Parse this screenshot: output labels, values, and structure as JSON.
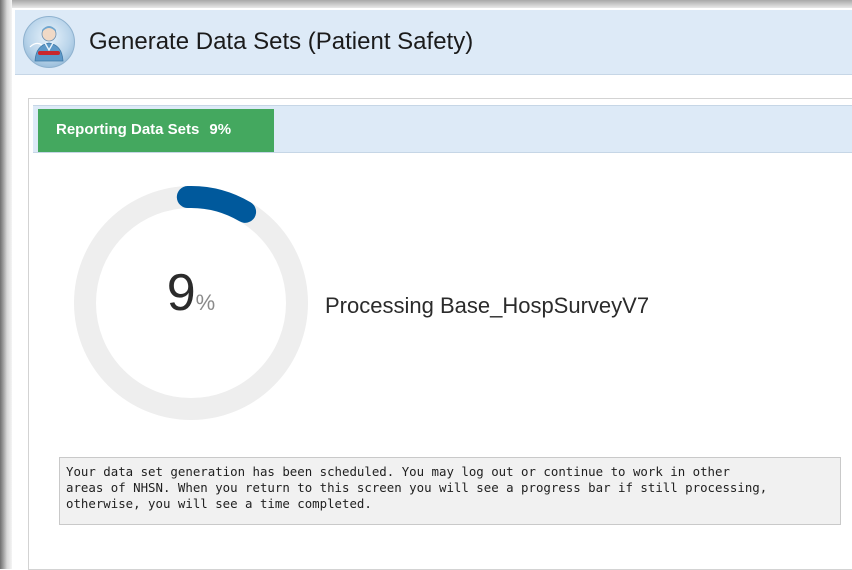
{
  "header": {
    "title": "Generate Data Sets (Patient Safety)",
    "logo_icon": "nhsn-clinician-icon"
  },
  "tabs": [
    {
      "label": "Reporting Data Sets",
      "percent_text": "9%",
      "active": true,
      "color": "#44a85f"
    }
  ],
  "progress": {
    "value_percent": 9,
    "number_text": "9",
    "unit_text": "%",
    "status_text": "Processing Base_HospSurveyV7",
    "track_color": "#eeeeee",
    "fill_color": "#00599c"
  },
  "notice": {
    "lines": [
      "Your data set generation has been scheduled. You may log out or continue to work in other",
      "areas of NHSN. When you return to this screen you will see a progress bar if still processing,",
      "otherwise, you will see a time completed."
    ]
  }
}
